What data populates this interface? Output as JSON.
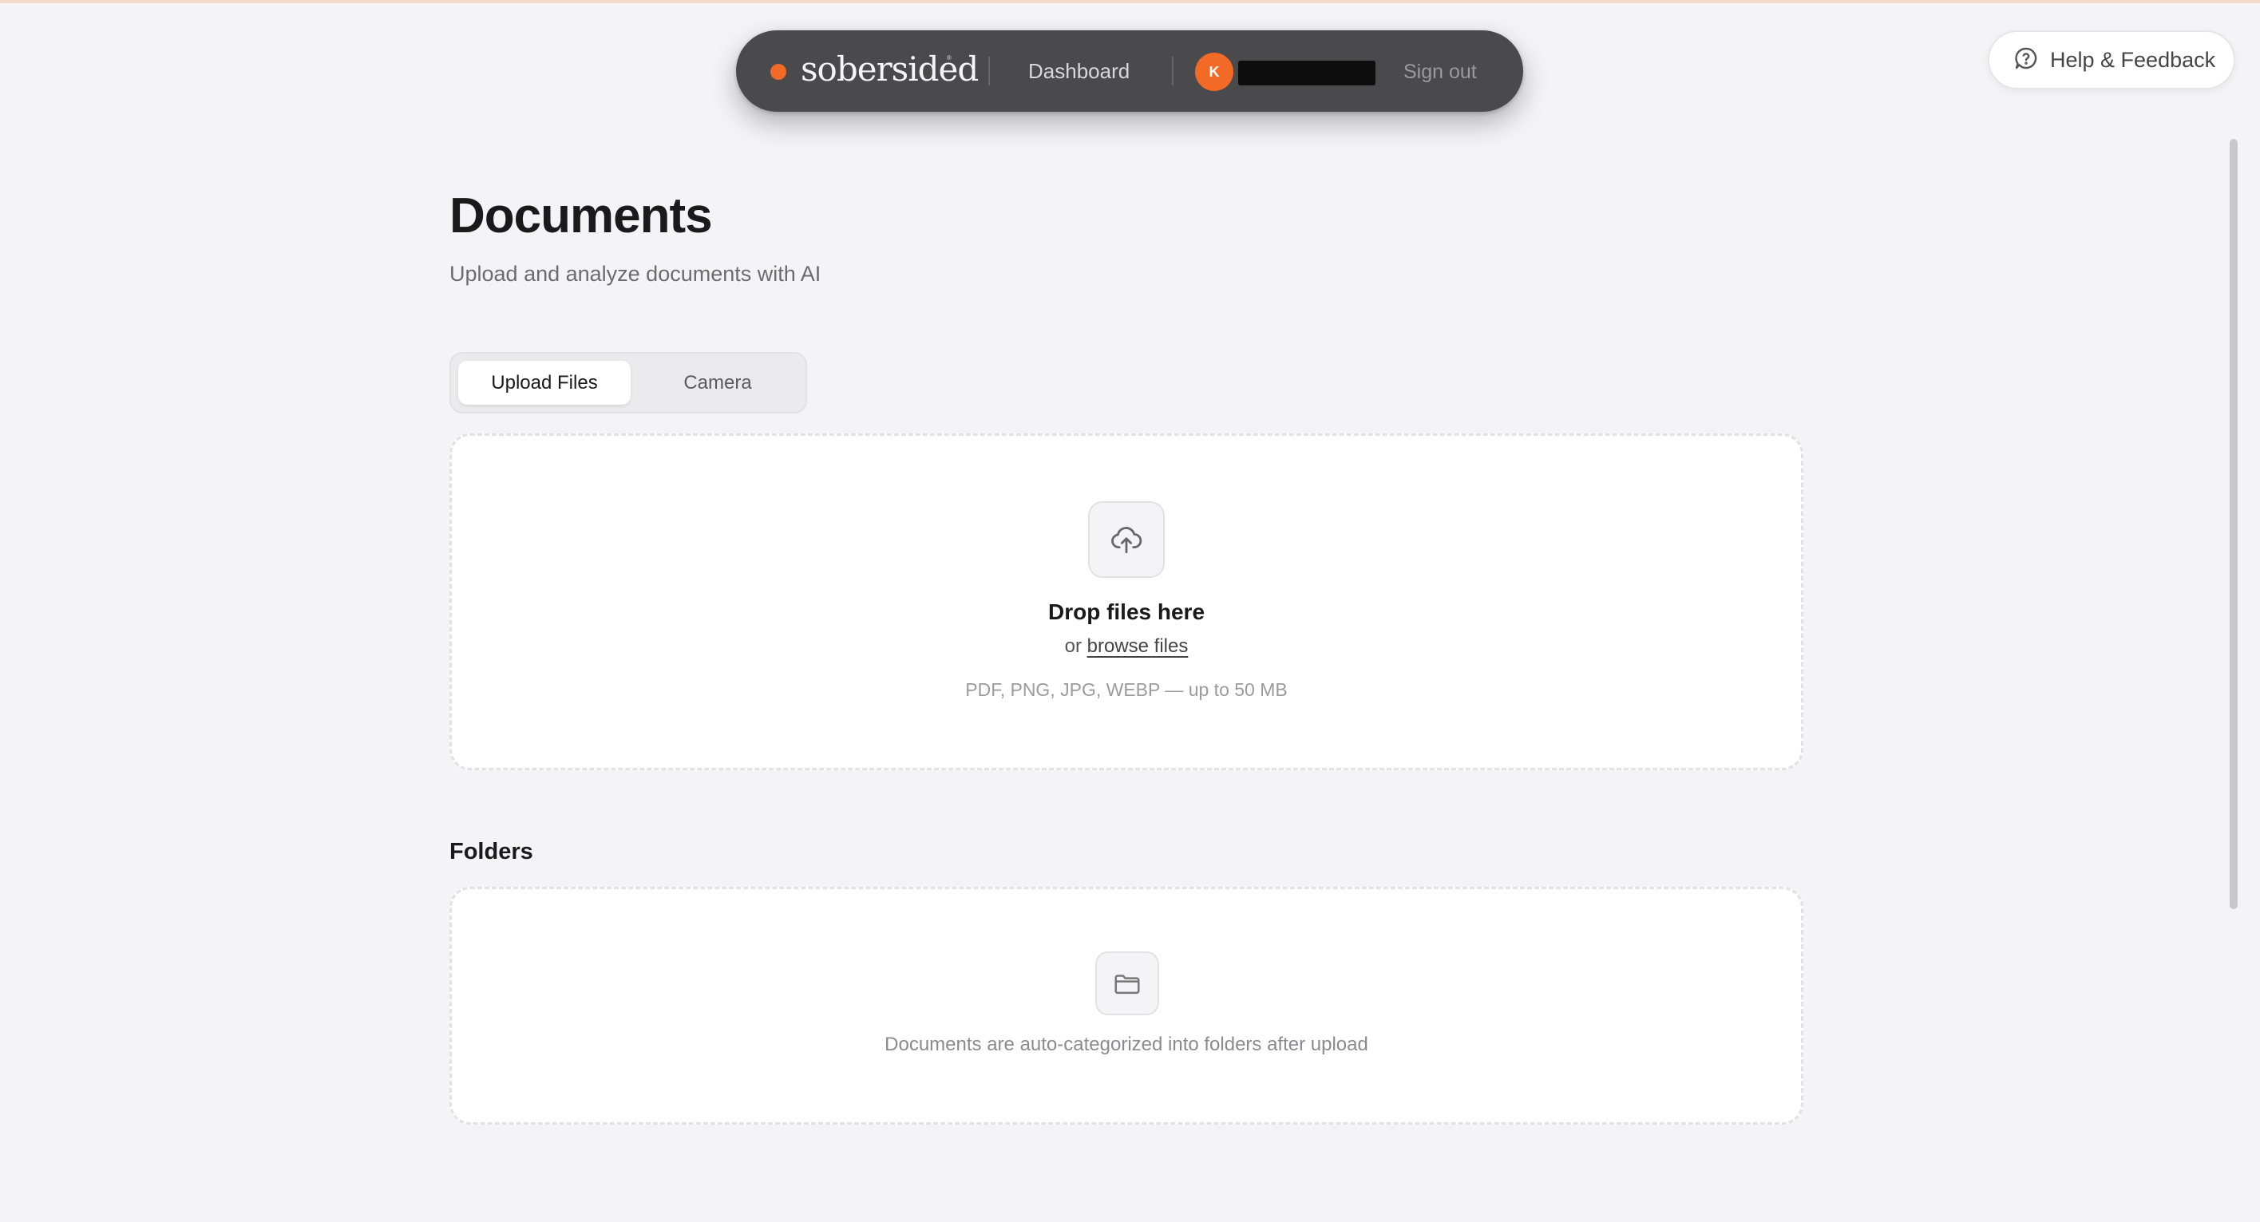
{
  "nav": {
    "brand": "sobersided",
    "brand_mark": "®",
    "dashboard_label": "Dashboard",
    "avatar_initial": "K",
    "sign_out_label": "Sign out",
    "accent_color": "#f26a26",
    "background_color": "#4a4a4c"
  },
  "help": {
    "label": "Help & Feedback",
    "icon": "help-circle-icon"
  },
  "page": {
    "title": "Documents",
    "subtitle": "Upload and analyze documents with AI"
  },
  "tabs": [
    {
      "label": "Upload Files",
      "active": true
    },
    {
      "label": "Camera",
      "active": false
    }
  ],
  "dropzone": {
    "icon": "cloud-upload-icon",
    "title": "Drop files here",
    "or_text": "or",
    "browse_label": "browse files",
    "hint": "PDF, PNG, JPG, WEBP — up to 50 MB"
  },
  "folders": {
    "heading": "Folders",
    "icon": "folder-icon",
    "empty_text": "Documents are auto-categorized into folders after upload"
  }
}
